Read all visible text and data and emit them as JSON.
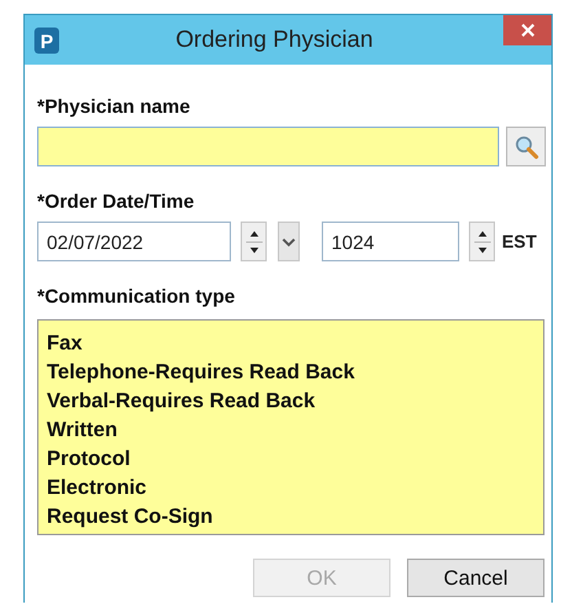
{
  "window": {
    "title": "Ordering Physician",
    "app_icon": "P"
  },
  "physician_name": {
    "label": "*Physician name"
  },
  "order_date_time": {
    "label": "*Order Date/Time",
    "date": "02/07/2022",
    "time": "1024",
    "timezone": "EST"
  },
  "communication_type": {
    "label": "*Communication type",
    "items": [
      {
        "label": "Fax",
        "selected": false
      },
      {
        "label": "Telephone-Requires Read Back",
        "selected": false
      },
      {
        "label": "Verbal-Requires Read Back",
        "selected": false
      },
      {
        "label": "Written",
        "selected": false
      },
      {
        "label": "Protocol",
        "selected": false
      },
      {
        "label": "Electronic",
        "selected": false
      },
      {
        "label": "Request Co-Sign",
        "selected": false
      }
    ]
  },
  "buttons": [
    {
      "label": "OK",
      "disabled": true
    },
    {
      "label": "Cancel",
      "disabled": false
    }
  ]
}
